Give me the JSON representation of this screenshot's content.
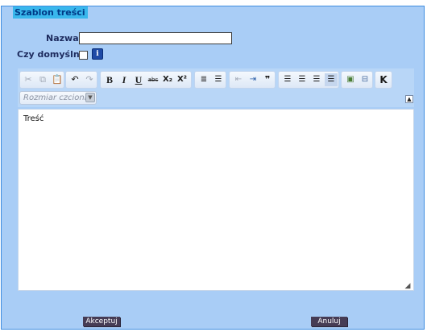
{
  "dialog": {
    "legend": "Szablon treści"
  },
  "form": {
    "name_label": "Nazwa:",
    "name_value": "",
    "default_label": "Czy domyślny:",
    "default_checked": false
  },
  "toolbar": {
    "icons": {
      "cut": "cut-icon",
      "copy": "copy-icon",
      "paste": "paste-icon",
      "undo": "undo-icon",
      "redo": "redo-icon",
      "bold": "bold-icon",
      "italic": "italic-icon",
      "underline": "underline-icon",
      "strike": "strikethrough-icon",
      "subscript": "subscript-icon",
      "superscript": "superscript-icon",
      "ordered_list": "ordered-list-icon",
      "unordered_list": "unordered-list-icon",
      "outdent": "outdent-icon",
      "indent": "indent-icon",
      "blockquote": "blockquote-icon",
      "align_left": "align-left-icon",
      "align_center": "align-center-icon",
      "align_right": "align-right-icon",
      "justify": "justify-icon",
      "image": "image-icon",
      "template": "template-icon",
      "clear_format": "clear-format-icon"
    },
    "bold_glyph": "B",
    "italic_glyph": "I",
    "underline_glyph": "U",
    "strike_glyph": "abc",
    "subscript_glyph": "X₂",
    "superscript_glyph": "X²",
    "blockquote_glyph": "❞",
    "clear_glyph": "K",
    "font_size_placeholder": "Rozmiar czcionki"
  },
  "editor": {
    "content": "Treść"
  },
  "actions": {
    "accept": "Akceptuj",
    "cancel": "Anuluj"
  },
  "colors": {
    "panel": "#a9cdf6",
    "border": "#3e8de0",
    "legend_bg": "#39b7ec",
    "button": "#463c55"
  }
}
